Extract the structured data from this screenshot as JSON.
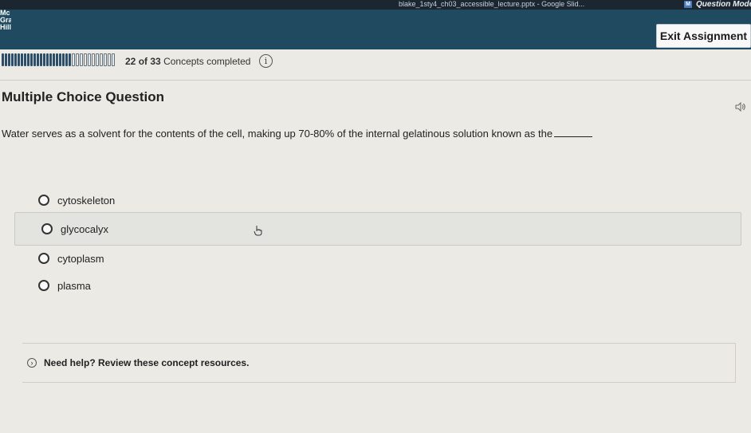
{
  "system_bar": {
    "file_title": "blake_1sty4_ch03_accessible_lecture.pptx - Google Slid...",
    "badge": "M",
    "mode": "Question Mode"
  },
  "header": {
    "brand": "Mc\nGraw\nHill",
    "exit_label": "Exit Assignment"
  },
  "progress": {
    "completed": 22,
    "total": 33,
    "current": "22",
    "of_total": "of 33",
    "label": "Concepts completed",
    "info_icon": "i"
  },
  "question": {
    "heading": "Multiple Choice Question",
    "text": "Water serves as a solvent for the contents of the cell, making up 70-80% of the internal gelatinous solution known as the",
    "options": [
      {
        "label": "cytoskeleton"
      },
      {
        "label": "glycocalyx"
      },
      {
        "label": "cytoplasm"
      },
      {
        "label": "plasma"
      }
    ]
  },
  "help": {
    "label": "Need help? Review these concept resources."
  },
  "icons": {
    "speaker": "speaker-icon",
    "info": "info-icon",
    "chevron": "chevron-right-icon",
    "cursor": "hand-cursor-icon"
  },
  "colors": {
    "header_bg": "#1f4a5f",
    "system_bar_bg": "#1b2631",
    "page_bg": "#eceae4"
  }
}
